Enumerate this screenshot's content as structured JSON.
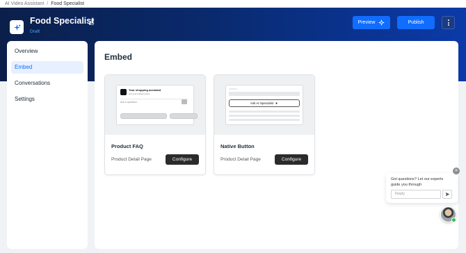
{
  "breadcrumb": {
    "root": "AI Video Assistant",
    "separator": "/",
    "current": "Food Specialist"
  },
  "header": {
    "title": "Food Specialist",
    "status": "Draft",
    "preview_label": "Preview",
    "publish_label": "Publish",
    "icons": {
      "app": "sparkle-icon",
      "edit": "pencil-icon",
      "preview": "sparkle-icon",
      "more": "more-vertical-icon"
    }
  },
  "sidebar": {
    "items": [
      {
        "label": "Overview",
        "active": false
      },
      {
        "label": "Embed",
        "active": true
      },
      {
        "label": "Conversations",
        "active": false
      },
      {
        "label": "Settings",
        "active": false
      }
    ]
  },
  "main": {
    "title": "Embed",
    "cards": [
      {
        "name": "Product FAQ",
        "location": "Product Detail Page",
        "button": "Configure",
        "preview": {
          "heading": "Your shopping assistant",
          "subheading": "Get your answers here",
          "input_placeholder": "Ask a Question"
        }
      },
      {
        "name": "Native Button",
        "location": "Product Detail Page",
        "button": "Configure",
        "preview": {
          "button_label": "Ask AI Specialist"
        }
      }
    ]
  },
  "chat_widget": {
    "message": "Got questions? Let our experts guide you through",
    "input_placeholder": "Reply",
    "icons": {
      "send": "send-icon",
      "close": "close-icon",
      "avatar": "avatar"
    },
    "colors": {
      "online": "#2fbf4a"
    }
  },
  "colors": {
    "accent": "#116dff",
    "header_dark": "#0b1f4a",
    "header_light": "#0b3aa8",
    "configure_button": "#2b2b2b"
  }
}
